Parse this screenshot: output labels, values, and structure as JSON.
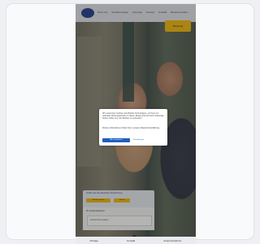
{
  "nav": {
    "items": [
      "Über uns",
      "Versicherungen",
      "Vorsorge",
      "Service",
      "Kontakt",
      "Beratung finden"
    ],
    "cta_label": "Beratung"
  },
  "cookie_modal": {
    "text1": "Wir verwenden Cookies und ähnliche Technologien, um Ihnen ein optimales Nutzungserlebnis zu bieten. Einige sind technisch notwendig, andere helfen uns, die Website zu verbessern.",
    "text2": "Weitere Informationen finden Sie in unserer Datenschutzerklärung.",
    "accept_label": "Alle akzeptieren",
    "manage_label": "Einstellungen"
  },
  "promo": {
    "title": "Finden Sie die passende Versicherung",
    "button1": "Jetzt berechnen",
    "button2": "Termin"
  },
  "info": {
    "title": "Ihr Ansprechpartner",
    "box_text": "Postleitzahl eingeben"
  },
  "bottom_bar": {
    "items": [
      "Anfrage",
      "Kontakt",
      "Ansprechpartner"
    ]
  }
}
